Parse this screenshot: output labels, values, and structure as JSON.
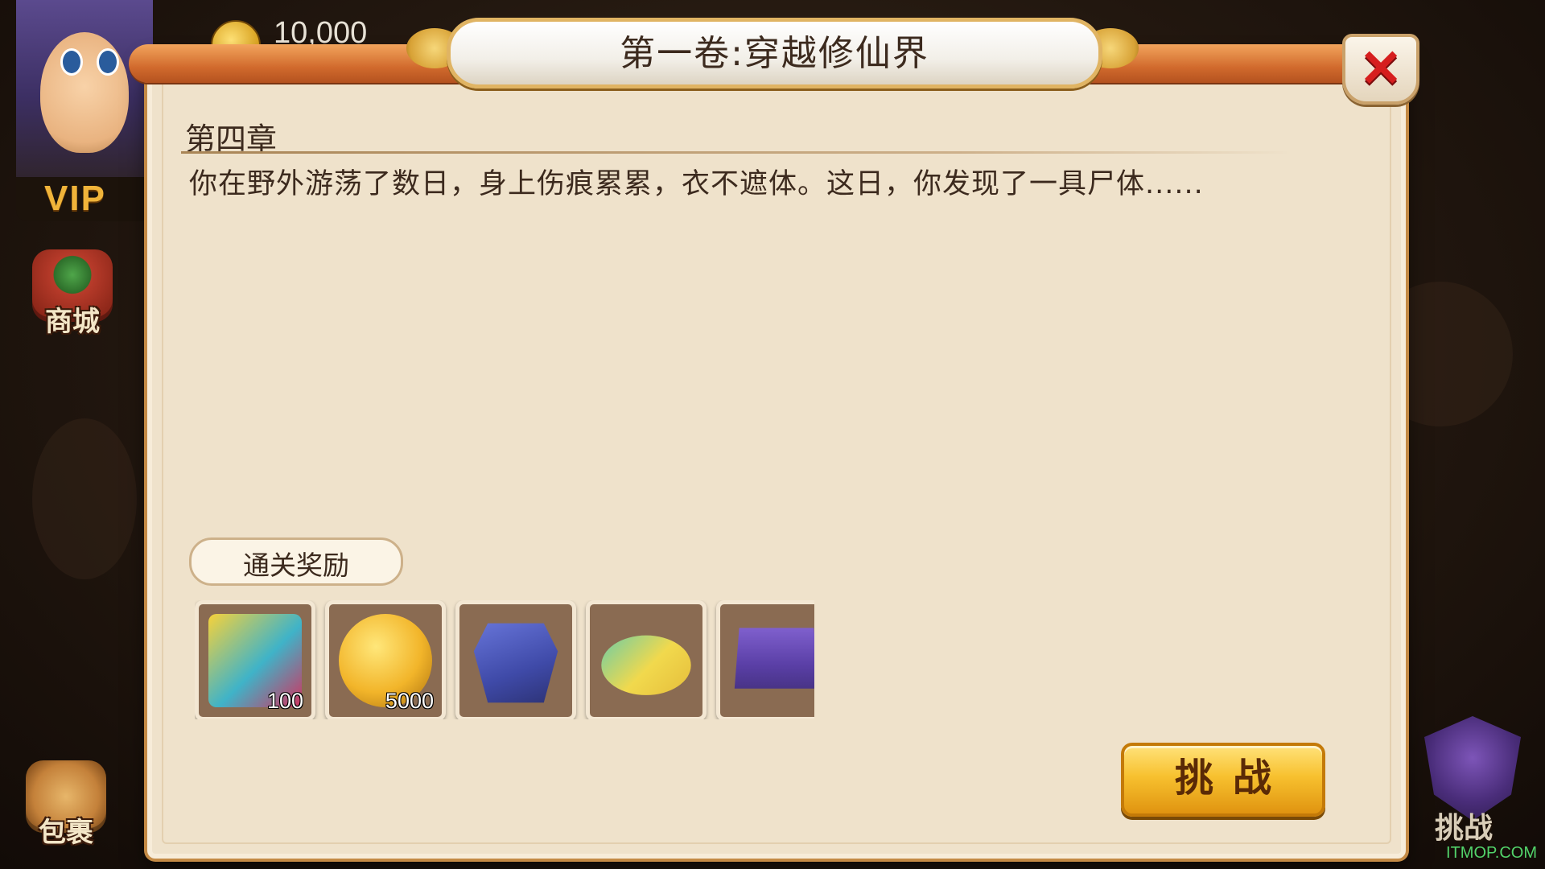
{
  "hud": {
    "coin_amount": "10,000",
    "vip_label": "VIP",
    "store_label": "商城",
    "bag_label": "包裹",
    "challenge_label": "挑战"
  },
  "dialog": {
    "title": "第一卷:穿越修仙界",
    "close_symbol": "✕",
    "chapter": "第四章",
    "story": "你在野外游荡了数日，身上伤痕累累，衣不遮体。这日，你发现了一具尸体......",
    "reward_label": "通关奖励",
    "rewards": [
      {
        "icon": "exp-icon",
        "quantity": "100"
      },
      {
        "icon": "gold-coin-icon",
        "quantity": "5000"
      },
      {
        "icon": "robe-icon",
        "quantity": ""
      },
      {
        "icon": "shoes-icon",
        "quantity": ""
      },
      {
        "icon": "belt-icon",
        "quantity": ""
      }
    ],
    "challenge_button": "挑战"
  },
  "watermark": "ITMOP.COM",
  "colors": {
    "accent_orange": "#d16a2d",
    "parchment": "#efe2cb",
    "close_red": "#d61e1e",
    "button_gold": "#f7c12f"
  }
}
